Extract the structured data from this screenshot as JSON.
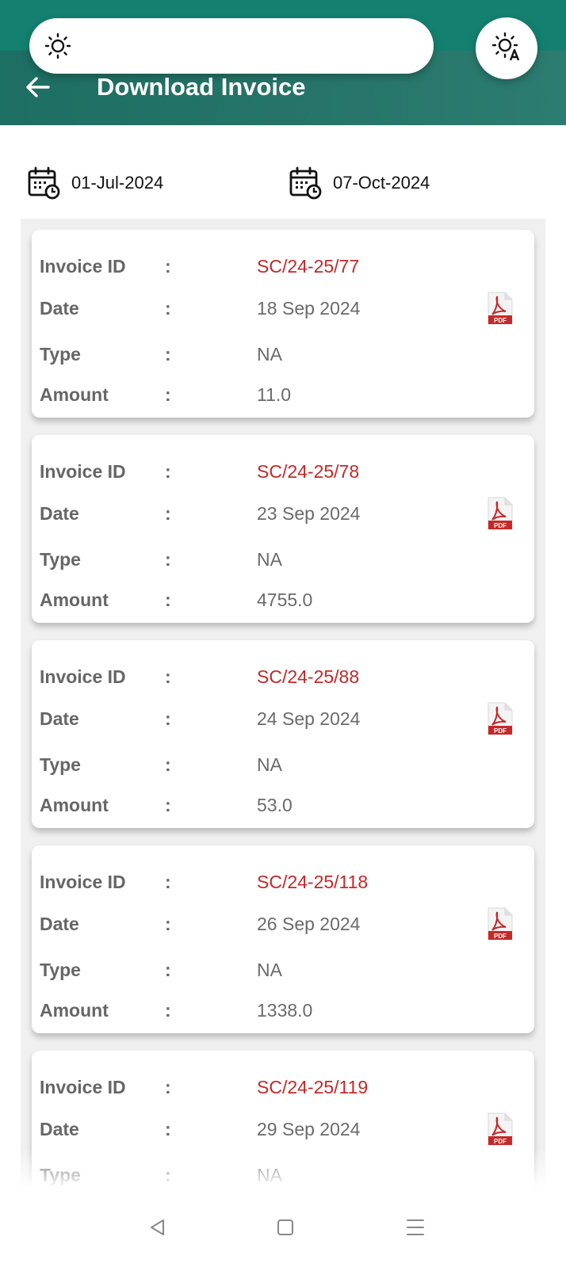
{
  "header": {
    "title": "Download Invoice",
    "icons": {
      "pill": "brightness-icon",
      "right": "auto-brightness-icon",
      "back": "arrow-left-icon"
    }
  },
  "date_range": {
    "from": "01-Jul-2024",
    "to": "07-Oct-2024",
    "icon": "calendar-clock-icon"
  },
  "labels": {
    "invoice_id": "Invoice ID",
    "date": "Date",
    "type": "Type",
    "amount": "Amount",
    "separator": ":"
  },
  "invoices": [
    {
      "id": "SC/24-25/77",
      "date": "18 Sep 2024",
      "type": "NA",
      "amount": "11.0"
    },
    {
      "id": "SC/24-25/78",
      "date": "23 Sep 2024",
      "type": "NA",
      "amount": "4755.0"
    },
    {
      "id": "SC/24-25/88",
      "date": "24 Sep 2024",
      "type": "NA",
      "amount": "53.0"
    },
    {
      "id": "SC/24-25/118",
      "date": "26 Sep 2024",
      "type": "NA",
      "amount": "1338.0"
    },
    {
      "id": "SC/24-25/119",
      "date": "29 Sep 2024",
      "type": "NA",
      "amount": ""
    }
  ],
  "colors": {
    "header": "#267468",
    "invoice_id": "#c62828",
    "label": "#666666"
  },
  "navbar": {
    "icons": [
      "nav-back-icon",
      "nav-home-icon",
      "nav-menu-icon"
    ]
  }
}
